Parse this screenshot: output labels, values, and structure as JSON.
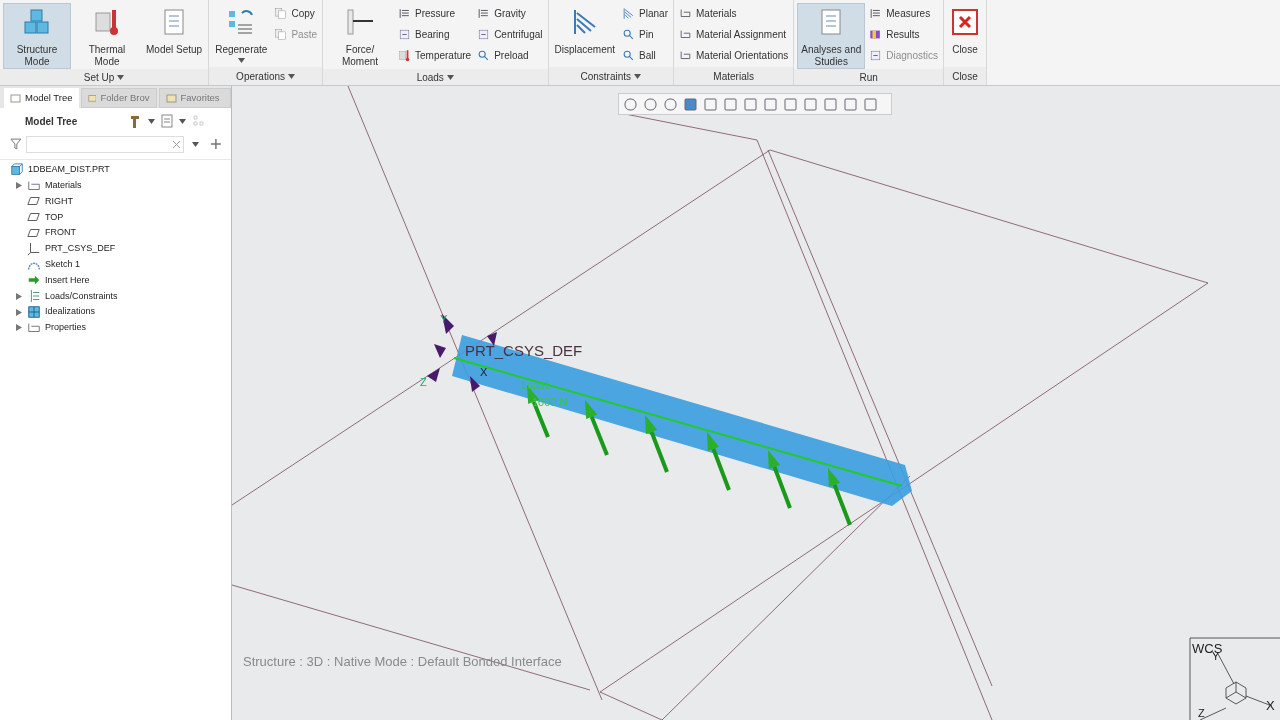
{
  "ribbon": {
    "groups": [
      {
        "label": "Set Up",
        "menu": true,
        "items": [
          {
            "label": "Structure Mode",
            "kind": "large",
            "selected": true
          },
          {
            "label": "Thermal Mode",
            "kind": "large",
            "selected": false
          },
          {
            "label": "Model Setup",
            "kind": "large",
            "selected": false
          }
        ]
      },
      {
        "label": "Operations",
        "menu": true,
        "items": [
          {
            "label": "Regenerate",
            "kind": "large",
            "selected": false,
            "dropdown": true
          },
          {
            "kind": "column",
            "entries": [
              {
                "label": "Copy",
                "disabled": false
              },
              {
                "label": "Paste",
                "disabled": true
              }
            ]
          }
        ]
      },
      {
        "label": "Loads",
        "menu": true,
        "items": [
          {
            "label": "Force/ Moment",
            "kind": "large",
            "selected": false
          },
          {
            "kind": "column",
            "entries": [
              {
                "label": "Pressure",
                "disabled": false
              },
              {
                "label": "Bearing",
                "disabled": false
              },
              {
                "label": "Temperature",
                "disabled": false
              }
            ]
          },
          {
            "kind": "column",
            "entries": [
              {
                "label": "Gravity",
                "disabled": false
              },
              {
                "label": "Centrifugal",
                "disabled": false
              },
              {
                "label": "Preload",
                "disabled": false
              }
            ]
          }
        ]
      },
      {
        "label": "Constraints",
        "menu": true,
        "items": [
          {
            "label": "Displacement",
            "kind": "large",
            "selected": false
          },
          {
            "kind": "column",
            "entries": [
              {
                "label": "Planar",
                "disabled": false
              },
              {
                "label": "Pin",
                "disabled": false
              },
              {
                "label": "Ball",
                "disabled": false
              }
            ]
          }
        ]
      },
      {
        "label": "Materials",
        "menu": false,
        "items": [
          {
            "kind": "column",
            "entries": [
              {
                "label": "Materials",
                "disabled": false
              },
              {
                "label": "Material Assignment",
                "disabled": false
              },
              {
                "label": "Material Orientations",
                "disabled": false
              }
            ]
          }
        ]
      },
      {
        "label": "Run",
        "menu": false,
        "items": [
          {
            "label": "Analyses and Studies",
            "kind": "large",
            "selected": true
          },
          {
            "kind": "column",
            "entries": [
              {
                "label": "Measures",
                "disabled": false
              },
              {
                "label": "Results",
                "disabled": false
              },
              {
                "label": "Diagnostics",
                "disabled": true
              }
            ]
          }
        ]
      },
      {
        "label": "Close",
        "menu": false,
        "items": [
          {
            "label": "Close",
            "kind": "large",
            "selected": false
          }
        ]
      }
    ]
  },
  "panel": {
    "tabs": [
      {
        "label": "Model Tree",
        "selected": true
      },
      {
        "label": "Folder Brov",
        "selected": false
      },
      {
        "label": "Favorites",
        "selected": false
      }
    ],
    "title": "Model Tree",
    "tree": [
      {
        "label": "1DBEAM_DIST.PRT",
        "kind": "part",
        "children": [
          {
            "label": "Materials",
            "kind": "folder",
            "expanded": false
          },
          {
            "label": "RIGHT",
            "kind": "plane"
          },
          {
            "label": "TOP",
            "kind": "plane"
          },
          {
            "label": "FRONT",
            "kind": "plane"
          },
          {
            "label": "PRT_CSYS_DEF",
            "kind": "csys"
          },
          {
            "label": "Sketch 1",
            "kind": "sketch"
          },
          {
            "label": "Insert Here",
            "kind": "insert"
          },
          {
            "label": "Loads/Constraints",
            "kind": "loads",
            "expanded": false
          },
          {
            "label": "Idealizations",
            "kind": "mesh",
            "expanded": false
          },
          {
            "label": "Properties",
            "kind": "folder",
            "expanded": false
          }
        ]
      }
    ]
  },
  "viewport": {
    "csys_label": "PRT_CSYS_DEF",
    "axis_labels": [
      "Y",
      "X",
      "Z"
    ],
    "load_label": "Load1",
    "load_value": "1000 N",
    "status": "Structure : 3D : Native Mode : Default Bonded Interface",
    "wcs": {
      "label": "WCS",
      "axes": [
        "Y",
        "X",
        "Z"
      ]
    }
  }
}
